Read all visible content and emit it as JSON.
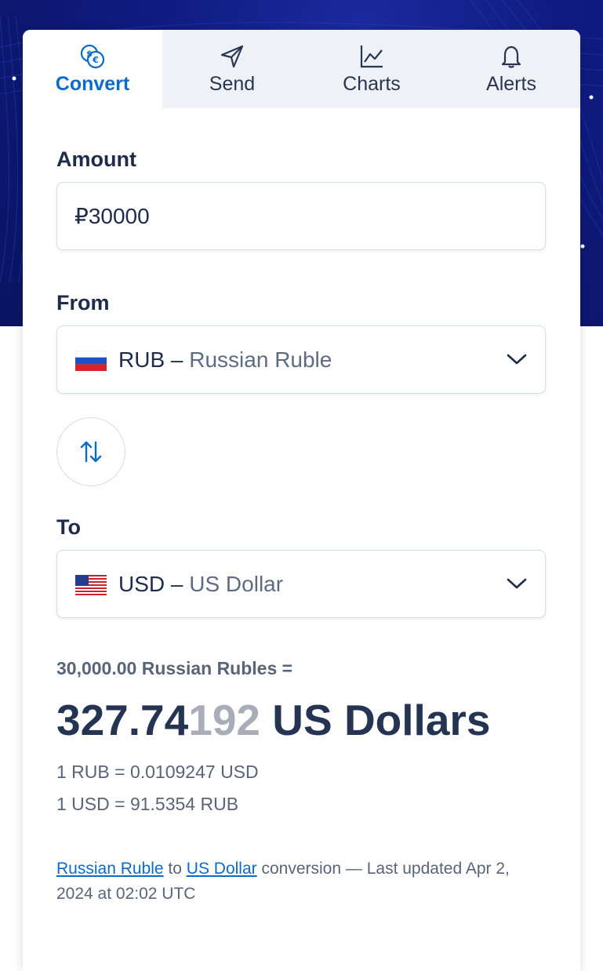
{
  "tabs": [
    {
      "label": "Convert",
      "icon": "currency-exchange-icon",
      "active": true
    },
    {
      "label": "Send",
      "icon": "paper-plane-icon",
      "active": false
    },
    {
      "label": "Charts",
      "icon": "line-chart-icon",
      "active": false
    },
    {
      "label": "Alerts",
      "icon": "bell-icon",
      "active": false
    }
  ],
  "amount": {
    "label": "Amount",
    "value": "₽30000"
  },
  "from": {
    "label": "From",
    "code": "RUB –",
    "name": "Russian Ruble",
    "flag_icon": "russia-flag-icon"
  },
  "to": {
    "label": "To",
    "code": "USD –",
    "name": "US Dollar",
    "flag_icon": "usa-flag-icon"
  },
  "result": {
    "from_text": "30,000.00 Russian Rubles =",
    "amount_strong": "327.74",
    "amount_faded": "192",
    "unit": "US Dollars"
  },
  "rates": {
    "forward": "1 RUB = 0.0109247 USD",
    "reverse": "1 USD = 91.5354 RUB"
  },
  "footer": {
    "link_from": "Russian Ruble",
    "to_word": "to",
    "link_to": "US Dollar",
    "rest": "conversion — Last updated Apr 2, 2024 at 02:02 UTC"
  },
  "colors": {
    "accent": "#0b6bcb",
    "hero_bg": "#0f1b80",
    "text": "#1e2b4a"
  }
}
